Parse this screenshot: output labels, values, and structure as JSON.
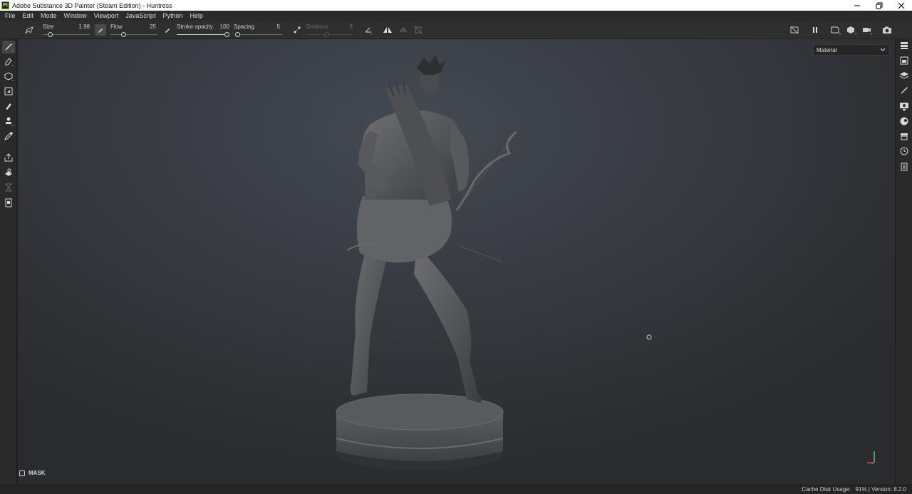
{
  "window": {
    "logo": "Pt",
    "title": "Adobe Substance 3D Painter (Steam Edition) - Huntress",
    "controls": [
      "minimize-icon",
      "restore-icon",
      "close-icon"
    ]
  },
  "menu": [
    {
      "id": "file",
      "label": "File"
    },
    {
      "id": "edit",
      "label": "Edit"
    },
    {
      "id": "mode",
      "label": "Mode"
    },
    {
      "id": "window",
      "label": "Window"
    },
    {
      "id": "viewport",
      "label": "Viewport"
    },
    {
      "id": "javascript",
      "label": "JavaScript"
    },
    {
      "id": "python",
      "label": "Python"
    },
    {
      "id": "help",
      "label": "Help"
    }
  ],
  "tool_properties": {
    "size": {
      "label": "Size",
      "value": "1.98",
      "fraction": 0.05
    },
    "flow": {
      "label": "Flow",
      "value": "25",
      "fraction": 0.25
    },
    "stroke_opacity": {
      "label": "Stroke opacity",
      "value": "100",
      "fraction": 1.0
    },
    "spacing": {
      "label": "Spacing",
      "value": "5",
      "fraction": 0.0
    },
    "distance": {
      "label": "Distance",
      "value": "8",
      "fraction": 0.4,
      "enabled": false
    }
  },
  "left_tools": [
    "paint-brush-icon",
    "eraser-icon",
    "projection-icon",
    "polygon-fill-icon",
    "smudge-icon",
    "clone-stamp-icon",
    "color-picker-icon",
    "export-icon",
    "bake-icon",
    "geometry-mask-icon",
    "clipboard-icon"
  ],
  "right_dock": [
    "layers-panel-icon",
    "texture-set-list-icon",
    "layer-stack-icon",
    "properties-icon",
    "display-settings-icon",
    "environment-icon",
    "shelf-icon",
    "history-icon",
    "log-icon"
  ],
  "viewport": {
    "display_mode": "Material",
    "mask_label": "MASK"
  },
  "status": {
    "cache_label": "Cache Disk Usage:",
    "cache_value": "91%",
    "version": "Version: 8.2.0"
  },
  "colors": {
    "accent_logo": "#7fae2a",
    "viewport_bg": "#393d43",
    "axis_x": "#d04848",
    "axis_y": "#5cc15c",
    "axis_z": "#4a70d8"
  }
}
